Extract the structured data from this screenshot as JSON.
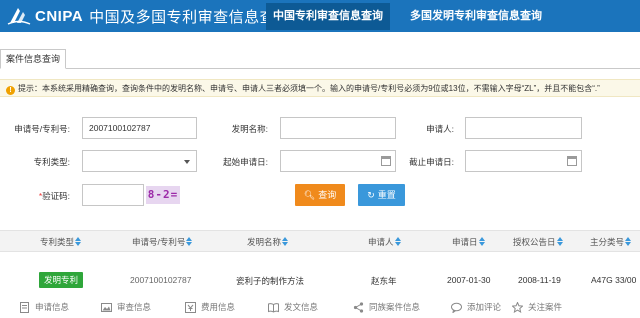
{
  "header": {
    "logo_text": "CNIPA",
    "logo_subtitle": "中国及多国专利审查信息查询",
    "tabs": [
      {
        "label": "中国专利审查信息查询",
        "active": true
      },
      {
        "label": "多国发明专利审查信息查询",
        "active": false
      }
    ],
    "bg_color": "#1b74bc",
    "active_tab_color": "#0d5a95"
  },
  "case_tab": {
    "label": "案件信息查询"
  },
  "tip": {
    "text": "提示：本系统采用精确查询，查询条件中的发明名称、申请号、申请人三者必须填一个。输入的申请号/专利号必须为9位或13位，不需输入字母“ZL”，并且不能包含“.”"
  },
  "form": {
    "app_no_label": "申请号/专利号:",
    "app_no_value": "2007100102787",
    "invention_name_label": "发明名称:",
    "invention_name_value": "",
    "applicant_label": "申请人:",
    "applicant_value": "",
    "patent_type_label": "专利类型:",
    "patent_type_value": "",
    "start_date_label": "起始申请日:",
    "start_date_value": "",
    "end_date_label": "截止申请日:",
    "end_date_value": "",
    "captcha_label": "验证码:",
    "captcha_required_mark": "*",
    "captcha_value": "",
    "captcha_image_text": "8-2="
  },
  "buttons": {
    "search_label": "查询",
    "reset_label": "重置",
    "search_color": "#f08a1c",
    "reset_color": "#3a98db"
  },
  "table": {
    "columns": [
      "专利类型",
      "申请号/专利号",
      "发明名称",
      "申请人",
      "申请日",
      "授权公告日",
      "主分类号"
    ],
    "rows": [
      {
        "type": "发明专利",
        "app_no": "2007100102787",
        "title": "瓷利子的制作方法",
        "applicant": "赵东年",
        "filing_date": "2007-01-30",
        "grant_date": "2008-11-19",
        "ipc": "A47G 33/00"
      }
    ],
    "badge_color": "#2fa63a"
  },
  "actions": [
    {
      "label": "申请信息",
      "icon": "document-icon"
    },
    {
      "label": "审查信息",
      "icon": "image-icon"
    },
    {
      "label": "费用信息",
      "icon": "fee-icon"
    },
    {
      "label": "发文信息",
      "icon": "book-icon"
    },
    {
      "label": "同族案件信息",
      "icon": "share-icon"
    },
    {
      "label": "添加评论",
      "icon": "comment-icon"
    },
    {
      "label": "关注案件",
      "icon": "star-icon"
    }
  ]
}
